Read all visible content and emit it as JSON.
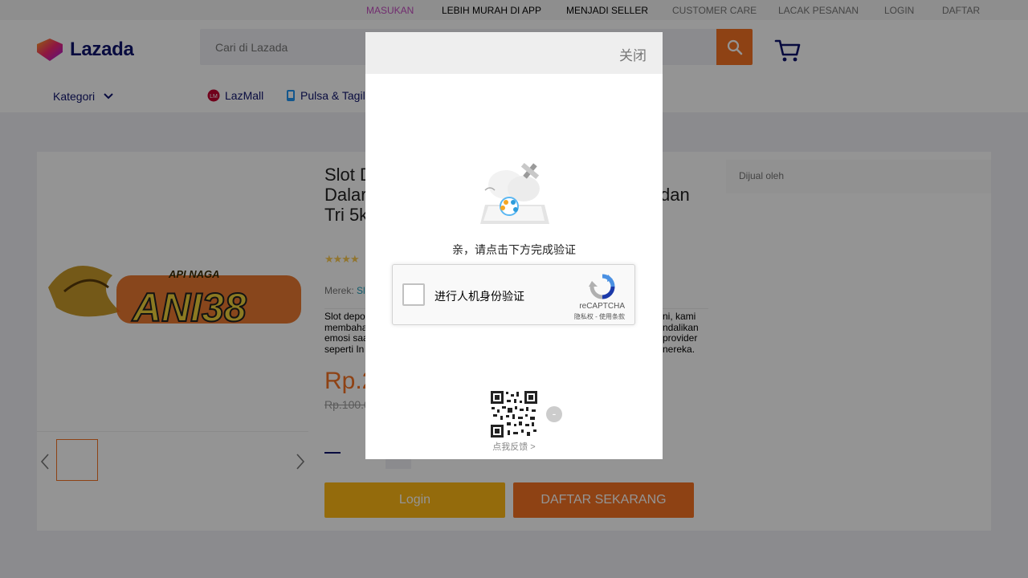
{
  "topbar": {
    "links": [
      {
        "label": "MASUKAN"
      },
      {
        "label": "LEBIH MURAH DI APP"
      },
      {
        "label": "MENJADI SELLER"
      },
      {
        "label": "CUSTOMER CARE"
      },
      {
        "label": "LACAK PESANAN"
      },
      {
        "label": "LOGIN"
      },
      {
        "label": "DAFTAR"
      }
    ]
  },
  "header": {
    "logo_text": "Lazada",
    "search_placeholder": "Cari di Lazada",
    "category_label": "Kategori",
    "nav": [
      {
        "label": "LazMall",
        "icon": "lazmall-icon"
      },
      {
        "label": "Pulsa & Tagil",
        "icon": "phone-icon"
      }
    ]
  },
  "product": {
    "title_lines": [
      "Slot D",
      "Dalar",
      "Tri 5k",
      "dan"
    ],
    "stars": "★★★★",
    "brand_label": "Merek:",
    "brand_value": "Sl",
    "description_left": [
      "Slot depo",
      "membaha",
      "emosi saa",
      "seperti In"
    ],
    "description_right": [
      "ni, kami",
      "ndalikan",
      "provider",
      "nereka."
    ],
    "price": "Rp.2",
    "old_price": "Rp.100.0",
    "login_label": "Login",
    "daftar_label": "DAFTAR SEKARANG",
    "seller_label": "Dijual oleh",
    "banner_logo_text": "ANI38",
    "banner_small_text": "API NAGA"
  },
  "modal": {
    "close_label": "关闭",
    "prompt": "亲，请点击下方完成验证",
    "recaptcha": {
      "label": "进行人机身份验证",
      "brand": "reCAPTCHA",
      "links": "隐私权 - 使用条款"
    },
    "qr_toggle": "-",
    "feedback": "点我反馈 >"
  },
  "colors": {
    "accent": "#f57224",
    "navy": "#0f146d",
    "login_button": "#ffb916"
  }
}
